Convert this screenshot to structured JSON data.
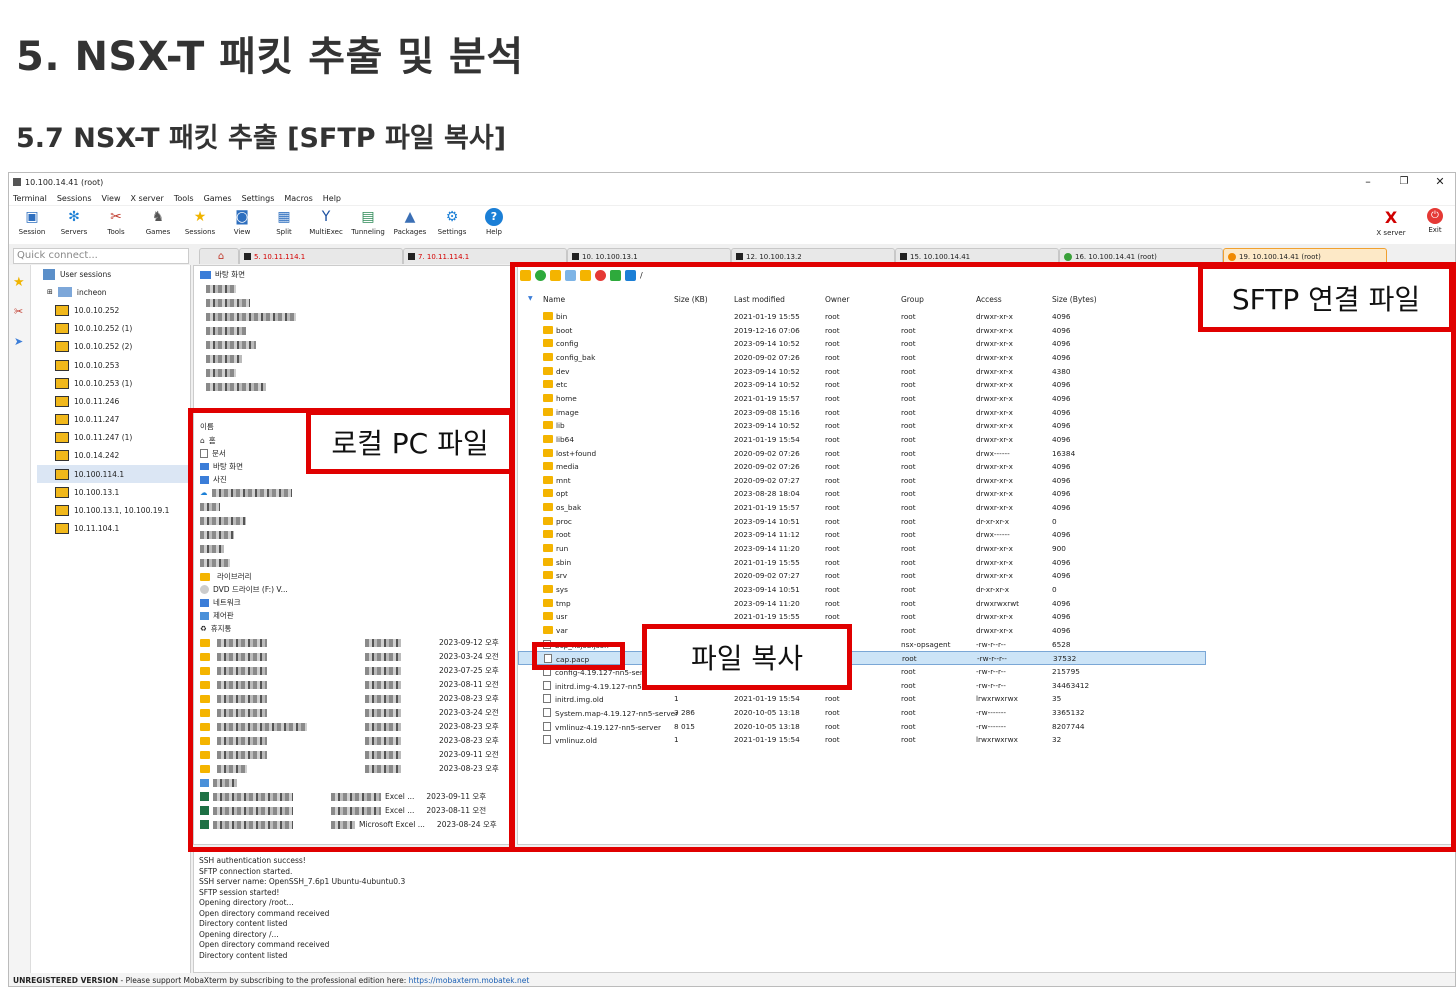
{
  "slide": {
    "title": "5. NSX-T 패킷 추출 및 분석",
    "subtitle": "5.7 NSX-T 패킷 추출 [SFTP 파일 복사]"
  },
  "app": {
    "window_title": "10.100.14.41 (root)",
    "menu": [
      "Terminal",
      "Sessions",
      "View",
      "X server",
      "Tools",
      "Games",
      "Settings",
      "Macros",
      "Help"
    ],
    "toolbar": [
      {
        "label": "Session",
        "icon": "monitor-icon"
      },
      {
        "label": "Servers",
        "icon": "servers-icon"
      },
      {
        "label": "Tools",
        "icon": "tools-icon"
      },
      {
        "label": "Games",
        "icon": "games-icon"
      },
      {
        "label": "Sessions",
        "icon": "star-icon"
      },
      {
        "label": "View",
        "icon": "view-icon"
      },
      {
        "label": "Split",
        "icon": "split-icon"
      },
      {
        "label": "MultiExec",
        "icon": "multiexec-icon"
      },
      {
        "label": "Tunneling",
        "icon": "tunneling-icon"
      },
      {
        "label": "Packages",
        "icon": "packages-icon"
      },
      {
        "label": "Settings",
        "icon": "settings-icon"
      },
      {
        "label": "Help",
        "icon": "help-icon"
      }
    ],
    "xserver_label": "X server",
    "exit_label": "Exit",
    "quick_connect_placeholder": "Quick connect...",
    "tabs": [
      {
        "label": "5. 10.11.114.1",
        "color": "#d40000"
      },
      {
        "label": "7. 10.11.114.1",
        "color": "#d40000"
      },
      {
        "label": "10. 10.100.13.1",
        "color": "#222222"
      },
      {
        "label": "12. 10.100.13.2",
        "color": "#222222"
      },
      {
        "label": "15. 10.100.14.41",
        "color": "#222222"
      },
      {
        "label": "16. 10.100.14.41 (root)",
        "color": "#222222"
      },
      {
        "label": "19. 10.100.14.41 (root)",
        "color": "#222222"
      }
    ],
    "sessions": {
      "root_label": "User sessions",
      "group_label": "incheon",
      "items": [
        "10.0.10.252",
        "10.0.10.252 (1)",
        "10.0.10.252 (2)",
        "10.0.10.253",
        "10.0.10.253 (1)",
        "10.0.11.246",
        "10.0.11.247",
        "10.0.11.247 (1)",
        "10.0.14.242",
        "10.100.114.1",
        "10.100.13.1",
        "10.100.13.1, 10.100.19.1",
        "10.11.104.1"
      ],
      "selected_index": 9
    },
    "local": {
      "tree_root": "바탕 화면",
      "column_name": "이름",
      "items": [
        "홈",
        "문서",
        "바탕 화면",
        "사진",
        "라이브러리",
        "DVD 드라이브 (F:) V...",
        "네트워크",
        "제어판",
        "휴지통"
      ],
      "dates": [
        "2023-09-12 오후",
        "2023-03-24 오전",
        "2023-07-25 오후",
        "2023-08-11 오전",
        "2023-08-23 오후",
        "2023-03-24 오전",
        "2023-08-23 오후",
        "2023-08-23 오후",
        "2023-09-11 오전",
        "2023-08-23 오후",
        "2023-09-11 오후",
        "2023-08-11 오전",
        "2023-08-24 오후"
      ],
      "excel_label": "Excel ...",
      "microsoft_excel_label": "Microsoft Excel ..."
    },
    "sftp": {
      "path": "/",
      "columns": [
        "Name",
        "Size (KB)",
        "Last modified",
        "Owner",
        "Group",
        "Access",
        "Size (Bytes)"
      ],
      "rows": [
        {
          "name": "bin",
          "size": "",
          "modified": "2021-01-19 15:55",
          "owner": "root",
          "group": "root",
          "access": "drwxr-xr-x",
          "bytes": "4096",
          "type": "dir"
        },
        {
          "name": "boot",
          "size": "",
          "modified": "2019-12-16 07:06",
          "owner": "root",
          "group": "root",
          "access": "drwxr-xr-x",
          "bytes": "4096",
          "type": "dir"
        },
        {
          "name": "config",
          "size": "",
          "modified": "2023-09-14 10:52",
          "owner": "root",
          "group": "root",
          "access": "drwxr-xr-x",
          "bytes": "4096",
          "type": "dir"
        },
        {
          "name": "config_bak",
          "size": "",
          "modified": "2020-09-02 07:26",
          "owner": "root",
          "group": "root",
          "access": "drwxr-xr-x",
          "bytes": "4096",
          "type": "dir"
        },
        {
          "name": "dev",
          "size": "",
          "modified": "2023-09-14 10:52",
          "owner": "root",
          "group": "root",
          "access": "drwxr-xr-x",
          "bytes": "4380",
          "type": "dir"
        },
        {
          "name": "etc",
          "size": "",
          "modified": "2023-09-14 10:52",
          "owner": "root",
          "group": "root",
          "access": "drwxr-xr-x",
          "bytes": "4096",
          "type": "dir"
        },
        {
          "name": "home",
          "size": "",
          "modified": "2021-01-19 15:57",
          "owner": "root",
          "group": "root",
          "access": "drwxr-xr-x",
          "bytes": "4096",
          "type": "dir"
        },
        {
          "name": "image",
          "size": "",
          "modified": "2023-09-08 15:16",
          "owner": "root",
          "group": "root",
          "access": "drwxr-xr-x",
          "bytes": "4096",
          "type": "dir"
        },
        {
          "name": "lib",
          "size": "",
          "modified": "2023-09-14 10:52",
          "owner": "root",
          "group": "root",
          "access": "drwxr-xr-x",
          "bytes": "4096",
          "type": "dir"
        },
        {
          "name": "lib64",
          "size": "",
          "modified": "2021-01-19 15:54",
          "owner": "root",
          "group": "root",
          "access": "drwxr-xr-x",
          "bytes": "4096",
          "type": "dir"
        },
        {
          "name": "lost+found",
          "size": "",
          "modified": "2020-09-02 07:26",
          "owner": "root",
          "group": "root",
          "access": "drwx------",
          "bytes": "16384",
          "type": "dir"
        },
        {
          "name": "media",
          "size": "",
          "modified": "2020-09-02 07:26",
          "owner": "root",
          "group": "root",
          "access": "drwxr-xr-x",
          "bytes": "4096",
          "type": "dir"
        },
        {
          "name": "mnt",
          "size": "",
          "modified": "2020-09-02 07:27",
          "owner": "root",
          "group": "root",
          "access": "drwxr-xr-x",
          "bytes": "4096",
          "type": "dir"
        },
        {
          "name": "opt",
          "size": "",
          "modified": "2023-08-28 18:04",
          "owner": "root",
          "group": "root",
          "access": "drwxr-xr-x",
          "bytes": "4096",
          "type": "dir"
        },
        {
          "name": "os_bak",
          "size": "",
          "modified": "2021-01-19 15:57",
          "owner": "root",
          "group": "root",
          "access": "drwxr-xr-x",
          "bytes": "4096",
          "type": "dir"
        },
        {
          "name": "proc",
          "size": "",
          "modified": "2023-09-14 10:51",
          "owner": "root",
          "group": "root",
          "access": "dr-xr-xr-x",
          "bytes": "0",
          "type": "dir"
        },
        {
          "name": "root",
          "size": "",
          "modified": "2023-09-14 11:12",
          "owner": "root",
          "group": "root",
          "access": "drwx------",
          "bytes": "4096",
          "type": "dir"
        },
        {
          "name": "run",
          "size": "",
          "modified": "2023-09-14 11:20",
          "owner": "root",
          "group": "root",
          "access": "drwxr-xr-x",
          "bytes": "900",
          "type": "dir"
        },
        {
          "name": "sbin",
          "size": "",
          "modified": "2021-01-19 15:55",
          "owner": "root",
          "group": "root",
          "access": "drwxr-xr-x",
          "bytes": "4096",
          "type": "dir"
        },
        {
          "name": "srv",
          "size": "",
          "modified": "2020-09-02 07:27",
          "owner": "root",
          "group": "root",
          "access": "drwxr-xr-x",
          "bytes": "4096",
          "type": "dir"
        },
        {
          "name": "sys",
          "size": "",
          "modified": "2023-09-14 10:51",
          "owner": "root",
          "group": "root",
          "access": "dr-xr-xr-x",
          "bytes": "0",
          "type": "dir"
        },
        {
          "name": "tmp",
          "size": "",
          "modified": "2023-09-14 11:20",
          "owner": "root",
          "group": "root",
          "access": "drwxrwxrwt",
          "bytes": "4096",
          "type": "dir"
        },
        {
          "name": "usr",
          "size": "",
          "modified": "2021-01-19 15:55",
          "owner": "root",
          "group": "root",
          "access": "drwxr-xr-x",
          "bytes": "4096",
          "type": "dir"
        },
        {
          "name": "var",
          "size": "",
          "modified": "",
          "owner": "",
          "group": "root",
          "access": "drwxr-xr-x",
          "bytes": "4096",
          "type": "dir"
        },
        {
          "name": "bcp_nsjob.json",
          "size": "",
          "modified": "",
          "owner": "",
          "group": "nsx-opsagent",
          "access": "-rw-r--r--",
          "bytes": "6528",
          "type": "file"
        },
        {
          "name": "cap.pacp",
          "size": "",
          "modified": "",
          "owner": "",
          "group": "root",
          "access": "-rw-r--r--",
          "bytes": "37532",
          "type": "file"
        },
        {
          "name": "config-4.19.127-nn5-server",
          "size": "",
          "modified": "",
          "owner": "",
          "group": "root",
          "access": "-rw-r--r--",
          "bytes": "215795",
          "type": "file"
        },
        {
          "name": "initrd.img-4.19.127-nn5-server",
          "size": "",
          "modified": "",
          "owner": "",
          "group": "root",
          "access": "-rw-r--r--",
          "bytes": "34463412",
          "type": "file"
        },
        {
          "name": "initrd.img.old",
          "size": "1",
          "modified": "2021-01-19 15:54",
          "owner": "root",
          "group": "root",
          "access": "lrwxrwxrwx",
          "bytes": "35",
          "type": "link"
        },
        {
          "name": "System.map-4.19.127-nn5-server",
          "size": "3 286",
          "modified": "2020-10-05 13:18",
          "owner": "root",
          "group": "root",
          "access": "-rw-------",
          "bytes": "3365132",
          "type": "file"
        },
        {
          "name": "vmlinuz-4.19.127-nn5-server",
          "size": "8 015",
          "modified": "2020-10-05 13:18",
          "owner": "root",
          "group": "root",
          "access": "-rw-------",
          "bytes": "8207744",
          "type": "file"
        },
        {
          "name": "vmlinuz.old",
          "size": "1",
          "modified": "2021-01-19 15:54",
          "owner": "root",
          "group": "root",
          "access": "lrwxrwxrwx",
          "bytes": "32",
          "type": "link"
        }
      ],
      "selected_index": 25
    },
    "console_lines": [
      "SSH authentication success!",
      "SFTP connection started.",
      "SSH server name: OpenSSH_7.6p1 Ubuntu-4ubuntu0.3",
      "SFTP session started!",
      "Opening directory /root...",
      "Open directory command received",
      "Directory content listed",
      "Opening directory /...",
      "Open directory command received",
      "Directory content listed"
    ],
    "status": {
      "label": "UNREGISTERED VERSION",
      "text": " -  Please support MobaXterm by subscribing to the professional edition here: ",
      "link": "https://mobaxterm.mobatek.net"
    }
  },
  "annotations": {
    "sftp_label": "SFTP 연결 파일",
    "local_label": "로컬 PC 파일",
    "copy_label": "파일 복사",
    "color": "#e00000"
  }
}
